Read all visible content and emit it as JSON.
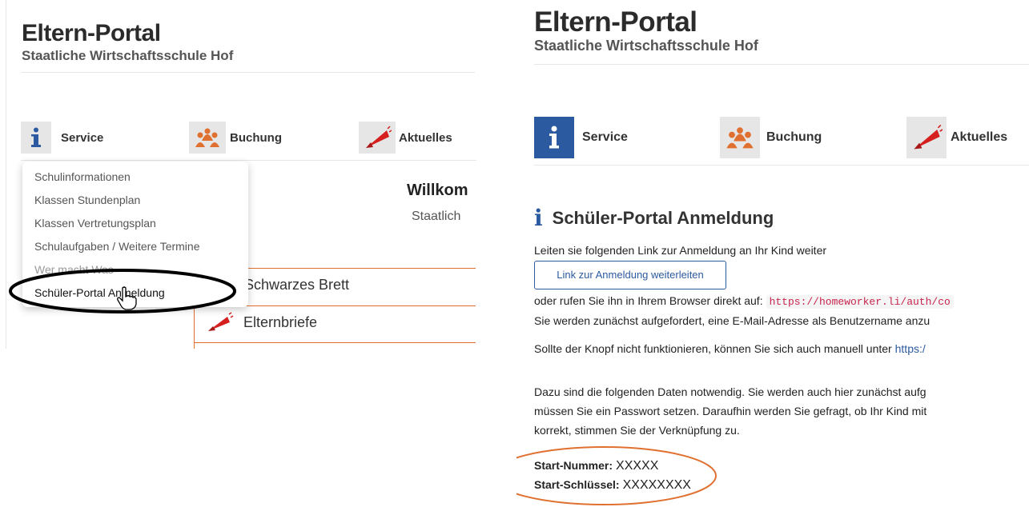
{
  "left": {
    "app_title": "Eltern-Portal",
    "school_name": "Staatliche Wirtschaftsschule Hof",
    "nav": [
      {
        "label": "Service",
        "icon": "info-icon"
      },
      {
        "label": "Buchung",
        "icon": "people-icon"
      },
      {
        "label": "Aktuelles",
        "icon": "megaphone-icon"
      }
    ],
    "dropdown_items": [
      "Schulinformationen",
      "Klassen Stundenplan",
      "Klassen Vertretungsplan",
      "Schulaufgaben / Weitere Termine",
      "Wer macht Was",
      "Schüler-Portal Anmeldung"
    ],
    "welcome_heading": "Willkom",
    "welcome_sub": "Staatlich",
    "news_items": [
      "Schwarzes Brett",
      "Elternbriefe"
    ]
  },
  "right": {
    "app_title": "Eltern-Portal",
    "school_name": "Staatliche Wirtschaftsschule Hof",
    "nav": [
      {
        "label": "Service",
        "icon": "info-icon",
        "active": true
      },
      {
        "label": "Buchung",
        "icon": "people-icon"
      },
      {
        "label": "Aktuelles",
        "icon": "megaphone-icon"
      }
    ],
    "section_title": "Schüler-Portal Anmeldung",
    "intro": "Leiten sie folgenden Link zur Anmeldung an Ihr Kind weiter",
    "forward_button": "Link zur Anmeldung weiterleiten",
    "direct_text": "oder rufen Sie ihn in Ihrem Browser direkt auf:",
    "direct_url": "https://homeworker.li/auth/co",
    "email_prompt": "Sie werden zunächst aufgefordert, eine E-Mail-Adresse als Benutzername anzu",
    "manual_text": "Sollte der Knopf nicht funktionieren, können Sie sich auch manuell unter",
    "manual_link": "https:/",
    "para1": "Dazu sind die folgenden Daten notwendig. Sie werden auch hier zunächst aufg",
    "para2": "müssen Sie ein Passwort setzen. Daraufhin werden Sie gefragt, ob Ihr Kind mit",
    "para3": "korrekt, stimmen Sie der Verknüpfung zu.",
    "credentials": {
      "start_nummer_label": "Start-Nummer:",
      "start_nummer_value": "XXXXX",
      "start_schluessel_label": "Start-Schlüssel:",
      "start_schluessel_value": "XXXXXXXX"
    }
  },
  "colors": {
    "accent_blue": "#2c5aa0",
    "accent_orange": "#e07030",
    "megaphone_red": "#d62020"
  }
}
